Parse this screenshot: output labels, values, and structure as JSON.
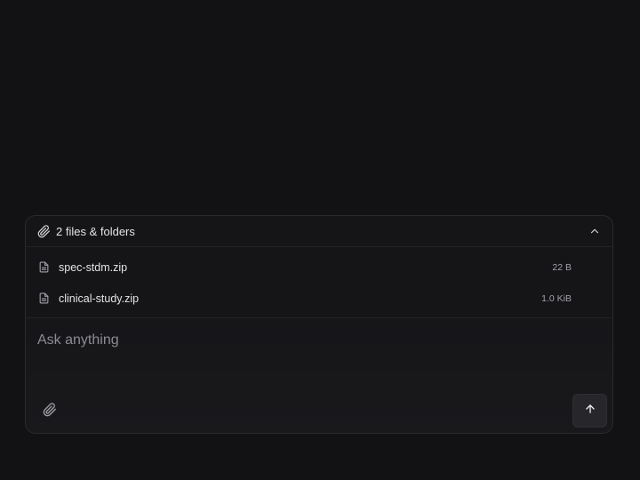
{
  "attachments": {
    "summary": "2 files & folders",
    "files": [
      {
        "name": "spec-stdm.zip",
        "size": "22 B"
      },
      {
        "name": "clinical-study.zip",
        "size": "1.0 KiB"
      }
    ]
  },
  "composer": {
    "placeholder": "Ask anything"
  },
  "icons": {
    "header": "paperclip-icon",
    "collapse": "chevron-up-icon",
    "file": "document-icon",
    "attach": "paperclip-icon",
    "send": "arrow-up-icon"
  },
  "colors": {
    "background": "#121214",
    "panel": "#151518",
    "border": "#2a2a2e",
    "text": "#e4e4e7",
    "muted": "#a1a1aa",
    "send_button": "#27272b"
  }
}
